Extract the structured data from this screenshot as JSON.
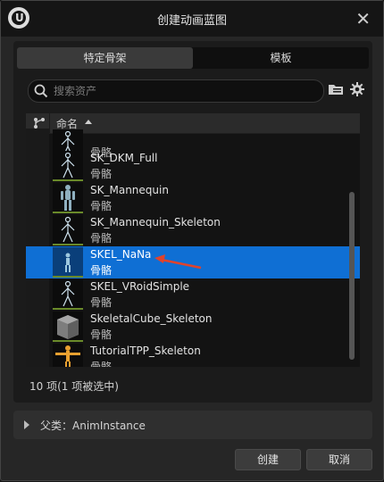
{
  "window": {
    "title": "创建动画蓝图"
  },
  "tabs": [
    {
      "label": "特定骨架",
      "active": true
    },
    {
      "label": "模板",
      "active": false
    }
  ],
  "search": {
    "placeholder": "搜索资产",
    "value": ""
  },
  "list": {
    "header": {
      "name_column": "命名",
      "sort": "ascending"
    },
    "rows": [
      {
        "name": "",
        "type": "骨骼",
        "selected": false,
        "thumb": "skeleton"
      },
      {
        "name": "SK_DKM_Full",
        "type": "骨骼",
        "selected": false,
        "thumb": "skeleton"
      },
      {
        "name": "SK_Mannequin",
        "type": "骨骼",
        "selected": false,
        "thumb": "mannequin"
      },
      {
        "name": "SK_Mannequin_Skeleton",
        "type": "骨骼",
        "selected": false,
        "thumb": "skeleton"
      },
      {
        "name": "SKEL_NaNa",
        "type": "骨骼",
        "selected": true,
        "thumb": "figure"
      },
      {
        "name": "SKEL_VRoidSimple",
        "type": "骨骼",
        "selected": false,
        "thumb": "skeleton"
      },
      {
        "name": "SkeletalCube_Skeleton",
        "type": "骨骼",
        "selected": false,
        "thumb": "cube"
      },
      {
        "name": "TutorialTPP_Skeleton",
        "type": "骨骼",
        "selected": false,
        "thumb": "tpose"
      }
    ],
    "status": "10 项(1 项被选中)"
  },
  "parent_class": {
    "label": "父类：AnimInstance"
  },
  "buttons": {
    "create": "创建",
    "cancel": "取消"
  },
  "colors": {
    "selection": "#0f6fd4",
    "annotation_arrow": "#e0432c"
  }
}
